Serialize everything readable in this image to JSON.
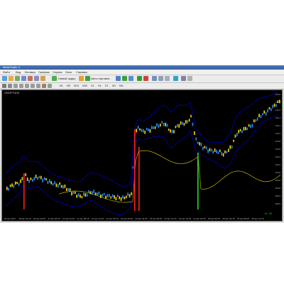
{
  "window": {
    "title": "MetaTrader 4",
    "menu": [
      "Файл",
      "Вид",
      "Вставка",
      "Графики",
      "Сервис",
      "Окно",
      "Справка"
    ]
  },
  "toolbar": {
    "new_order_label": "Новый ордер",
    "autotrade_label": "Авто-торговля",
    "timeframes": [
      "M1",
      "M5",
      "M15",
      "M30",
      "H1",
      "H4",
      "D1",
      "W1",
      "MN"
    ]
  },
  "chart": {
    "symbol": "USDJPY,M15",
    "y_labels": [
      "112.0",
      "111.8",
      "111.6",
      "111.4",
      "111.2",
      "111.0",
      "110.8",
      "110.6",
      "110.4",
      "110.2",
      "110.0",
      "109.8",
      "109.6",
      "109.4",
      "109.2"
    ],
    "x_labels": [
      "20 Apr 2017",
      "20 Apr 16:15",
      "20 Apr 20:15",
      "21 Apr 00:15",
      "21 Apr 04:15",
      "21 Apr 08:15",
      "21 Apr 12:15",
      "21 Apr 16:15",
      "24 Apr 00:15",
      "24 Apr 04:15",
      "24 Apr 08:15",
      "24 Apr 12:15",
      "24 Apr 16:15",
      "24 Apr 20:15",
      "25 Apr 00:15",
      "25 Apr 04:15",
      "25 Apr 08:15",
      "25 Apr 12:15"
    ],
    "corner_value": "14 : 33",
    "colors": {
      "bull": "#1e90ff",
      "bear": "#ffd700",
      "band": "#0000b4",
      "sub": "#c8b400",
      "bar_red": "#ff2020",
      "bar_green": "#20e020"
    }
  }
}
